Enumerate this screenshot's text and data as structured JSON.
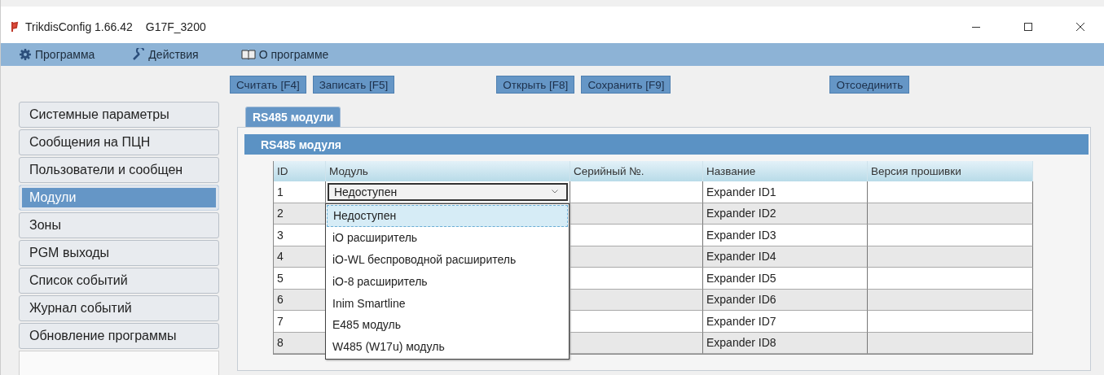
{
  "window": {
    "title": "TrikdisConfig 1.66.42",
    "device": "G17F_3200"
  },
  "menu": [
    {
      "label": "Программа",
      "kind": "settings"
    },
    {
      "label": "Действия",
      "kind": "actions"
    },
    {
      "label": "О программе",
      "kind": "about"
    }
  ],
  "toolbar": [
    [
      "Считать [F4]",
      "Записать [F5]"
    ],
    [
      "Открыть [F8]",
      "Сохранить [F9]"
    ],
    [
      "Отсоединить"
    ]
  ],
  "sidebar": {
    "items": [
      {
        "label": "Системные параметры",
        "selected": false
      },
      {
        "label": "Сообщения на ПЦН",
        "selected": false
      },
      {
        "label": "Пользователи и сообщен",
        "selected": false
      },
      {
        "label": "Модули",
        "selected": true
      },
      {
        "label": "Зоны",
        "selected": false
      },
      {
        "label": "PGM выходы",
        "selected": false
      },
      {
        "label": "Список событий",
        "selected": false
      },
      {
        "label": "Журнал событий",
        "selected": false
      },
      {
        "label": "Обновление программы",
        "selected": false
      }
    ]
  },
  "tabs": [
    {
      "label": "RS485 модули",
      "selected": true
    }
  ],
  "group": {
    "title": "RS485 модуля"
  },
  "table": {
    "columns": [
      "ID",
      "Модуль",
      "Серийный №.",
      "Название",
      "Версия прошивки"
    ],
    "rows": [
      {
        "id": "1",
        "module": "Недоступен",
        "name": "Expander ID1"
      },
      {
        "id": "2",
        "name": "Expander ID2"
      },
      {
        "id": "3",
        "name": "Expander ID3"
      },
      {
        "id": "4",
        "name": "Expander ID4"
      },
      {
        "id": "5",
        "name": "Expander ID5"
      },
      {
        "id": "6",
        "name": "Expander ID6"
      },
      {
        "id": "7",
        "name": "Expander ID7"
      },
      {
        "id": "8",
        "name": "Expander ID8"
      }
    ]
  },
  "dropdown": {
    "options": [
      {
        "label": "Недоступен",
        "selected": true
      },
      {
        "label": "iO расширитель",
        "selected": false
      },
      {
        "label": "iO-WL беспроводной расширитель",
        "selected": false
      },
      {
        "label": "iO-8 расширитель",
        "selected": false
      },
      {
        "label": "Inim Smartline",
        "selected": false
      },
      {
        "label": "E485 модуль",
        "selected": false
      },
      {
        "label": "W485 (W17u) модуль",
        "selected": false
      }
    ]
  }
}
